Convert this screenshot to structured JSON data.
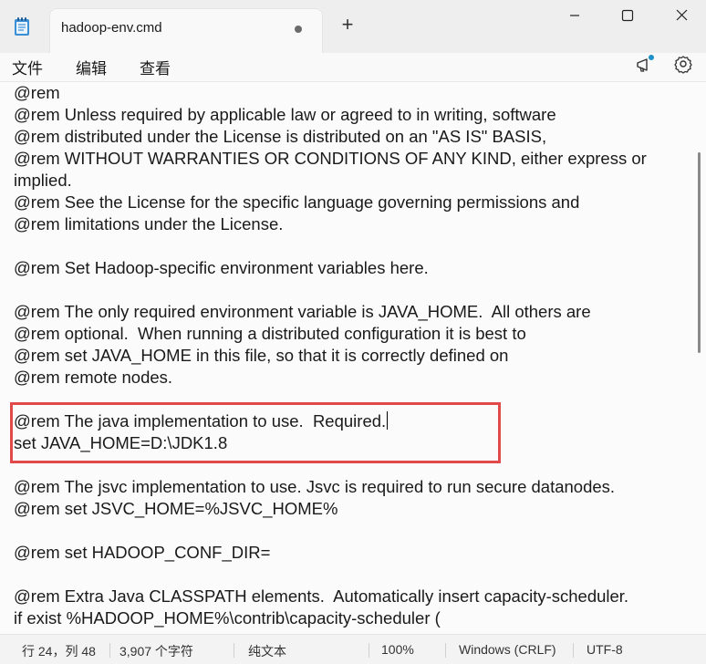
{
  "window": {
    "tab_title": "hadoop-env.cmd",
    "new_tab_label": "+"
  },
  "menu": {
    "file": "文件",
    "edit": "编辑",
    "view": "查看"
  },
  "icons": {
    "app": "notepad-icon",
    "unsaved": "unsaved-dot-icon",
    "announce": "megaphone-icon",
    "settings": "gear-icon",
    "minimize": "minimize-icon",
    "maximize": "maximize-icon",
    "close": "close-icon"
  },
  "colors": {
    "highlight_border": "#e04a4a",
    "notification_dot": "#1e90c8"
  },
  "editor": {
    "lines": [
      "@rem",
      "@rem Unless required by applicable law or agreed to in writing, software",
      "@rem distributed under the License is distributed on an \"AS IS\" BASIS,",
      "@rem WITHOUT WARRANTIES OR CONDITIONS OF ANY KIND, either express or",
      "implied.",
      "@rem See the License for the specific language governing permissions and",
      "@rem limitations under the License.",
      "",
      "@rem Set Hadoop-specific environment variables here.",
      "",
      "@rem The only required environment variable is JAVA_HOME.  All others are",
      "@rem optional.  When running a distributed configuration it is best to",
      "@rem set JAVA_HOME in this file, so that it is correctly defined on",
      "@rem remote nodes.",
      "",
      "@rem The java implementation to use.  Required.",
      "set JAVA_HOME=D:\\JDK1.8",
      "",
      "@rem The jsvc implementation to use. Jsvc is required to run secure datanodes.",
      "@rem set JSVC_HOME=%JSVC_HOME%",
      "",
      "@rem set HADOOP_CONF_DIR=",
      "",
      "@rem Extra Java CLASSPATH elements.  Automatically insert capacity-scheduler.",
      "if exist %HADOOP_HOME%\\contrib\\capacity-scheduler ("
    ]
  },
  "status": {
    "position": "行 24，列 48",
    "char_count": "3,907 个字符",
    "mode": "纯文本",
    "zoom": "100%",
    "line_ending": "Windows (CRLF)",
    "encoding": "UTF-8"
  }
}
